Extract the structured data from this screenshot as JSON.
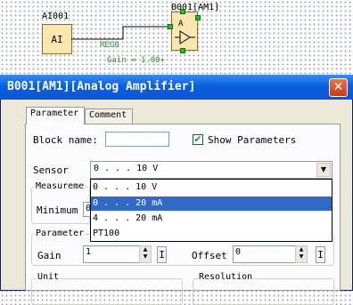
{
  "diagram": {
    "ai_name": "AI001",
    "ai_text": "AI",
    "amp_name": "B001[AM1]",
    "amp_symbol_top": "A",
    "param_ref": "REG0",
    "param_gain": "Gain = 1.00+"
  },
  "dialog": {
    "title": "B001[AM1][Analog Amplifier]",
    "tabs": [
      "Parameter",
      "Comment"
    ],
    "block_name_label": "Block name:",
    "block_name_value": "",
    "show_params_label": "Show Parameters",
    "show_params_checked": true,
    "sensor_label": "Sensor",
    "sensor_value": "0 . . . 10 V",
    "measurement_group": "Measureme",
    "minimum_label": "Minimum",
    "minimum_value": "0",
    "parameter_group": "Parameter",
    "gain_label": "Gain",
    "gain_value": "1",
    "offset_label": "Offset",
    "offset_value": "0",
    "i_label": "I",
    "unit_group": "Unit",
    "resolution_group": "Resolution",
    "sensor_options": [
      "0 . . . 10 V",
      "0 . . . 20 mA",
      "4 . . . 20 mA",
      "PT100"
    ],
    "selected_option_index": 1
  },
  "colors": {
    "titlebar": "#0b5fe0",
    "selection": "#316ac5",
    "block_fill": "#fde7b0",
    "pin": "#1fc41f"
  }
}
